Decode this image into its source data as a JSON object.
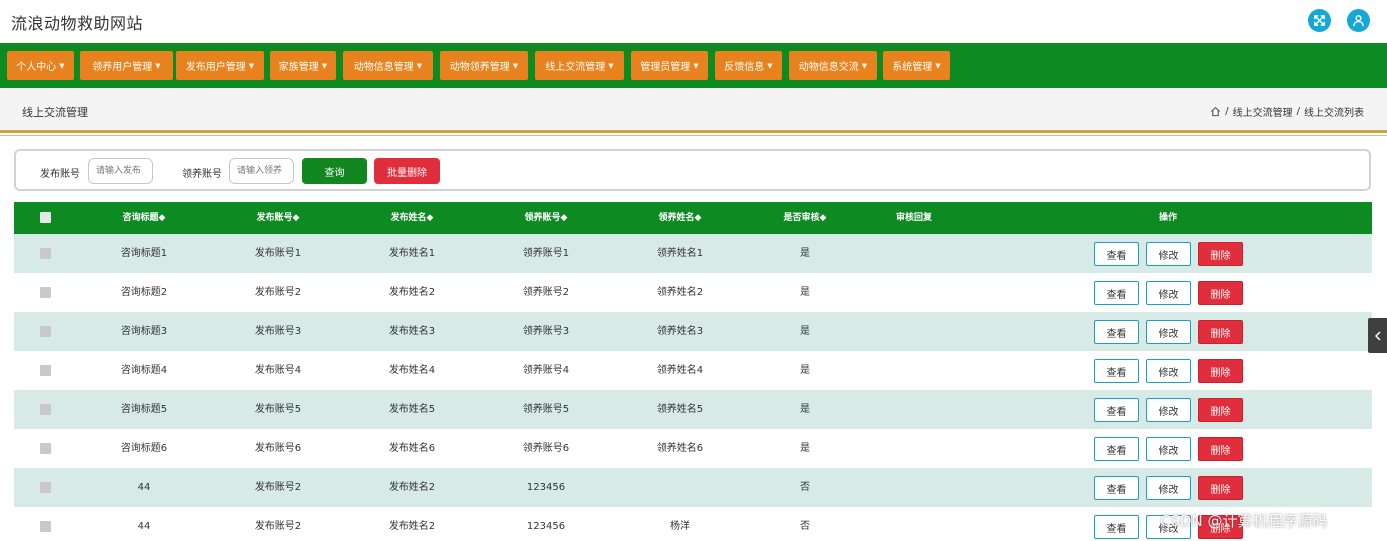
{
  "site": {
    "title": "流浪动物救助网站"
  },
  "colors": {
    "primary_green": "#0e8a22",
    "nav_orange": "#e8821e",
    "danger_red": "#e12e3c",
    "row_stripe": "#d7eae5",
    "icon_blue": "#15a8d6"
  },
  "nav": [
    {
      "label": "个人中心"
    },
    {
      "label": "领养用户管理"
    },
    {
      "label": "发布用户管理"
    },
    {
      "label": "家族管理"
    },
    {
      "label": "动物信息管理"
    },
    {
      "label": "动物领养管理"
    },
    {
      "label": "线上交流管理"
    },
    {
      "label": "管理员管理"
    },
    {
      "label": "反馈信息"
    },
    {
      "label": "动物信息交流"
    },
    {
      "label": "系统管理"
    }
  ],
  "page": {
    "title": "线上交流管理",
    "breadcrumb": [
      "线上交流管理",
      "线上交流列表"
    ],
    "breadcrumb_sep": "/"
  },
  "search": {
    "publish_label": "发布账号",
    "publish_placeholder": "请输入发布",
    "adopt_label": "领养账号",
    "adopt_placeholder": "请输入领养",
    "query_label": "查询",
    "batch_delete_label": "批量删除"
  },
  "table": {
    "columns": [
      "咨询标题◆",
      "发布账号◆",
      "发布姓名◆",
      "领养账号◆",
      "领养姓名◆",
      "是否审核◆",
      "审核回复",
      "操作"
    ],
    "actions": {
      "view": "查看",
      "edit": "修改",
      "delete": "删除"
    },
    "rows": [
      {
        "title": "咨询标题1",
        "pub_acct": "发布账号1",
        "pub_name": "发布姓名1",
        "adopt_acct": "领养账号1",
        "adopt_name": "领养姓名1",
        "audit": "是",
        "reply": ""
      },
      {
        "title": "咨询标题2",
        "pub_acct": "发布账号2",
        "pub_name": "发布姓名2",
        "adopt_acct": "领养账号2",
        "adopt_name": "领养姓名2",
        "audit": "是",
        "reply": ""
      },
      {
        "title": "咨询标题3",
        "pub_acct": "发布账号3",
        "pub_name": "发布姓名3",
        "adopt_acct": "领养账号3",
        "adopt_name": "领养姓名3",
        "audit": "是",
        "reply": ""
      },
      {
        "title": "咨询标题4",
        "pub_acct": "发布账号4",
        "pub_name": "发布姓名4",
        "adopt_acct": "领养账号4",
        "adopt_name": "领养姓名4",
        "audit": "是",
        "reply": ""
      },
      {
        "title": "咨询标题5",
        "pub_acct": "发布账号5",
        "pub_name": "发布姓名5",
        "adopt_acct": "领养账号5",
        "adopt_name": "领养姓名5",
        "audit": "是",
        "reply": ""
      },
      {
        "title": "咨询标题6",
        "pub_acct": "发布账号6",
        "pub_name": "发布姓名6",
        "adopt_acct": "领养账号6",
        "adopt_name": "领养姓名6",
        "audit": "是",
        "reply": ""
      },
      {
        "title": "44",
        "pub_acct": "发布账号2",
        "pub_name": "发布姓名2",
        "adopt_acct": "123456",
        "adopt_name": "",
        "audit": "否",
        "reply": ""
      },
      {
        "title": "44",
        "pub_acct": "发布账号2",
        "pub_name": "发布姓名2",
        "adopt_acct": "123456",
        "adopt_name": "杨洋",
        "audit": "否",
        "reply": ""
      }
    ]
  },
  "watermark": "CSDN @计算机程序源码"
}
